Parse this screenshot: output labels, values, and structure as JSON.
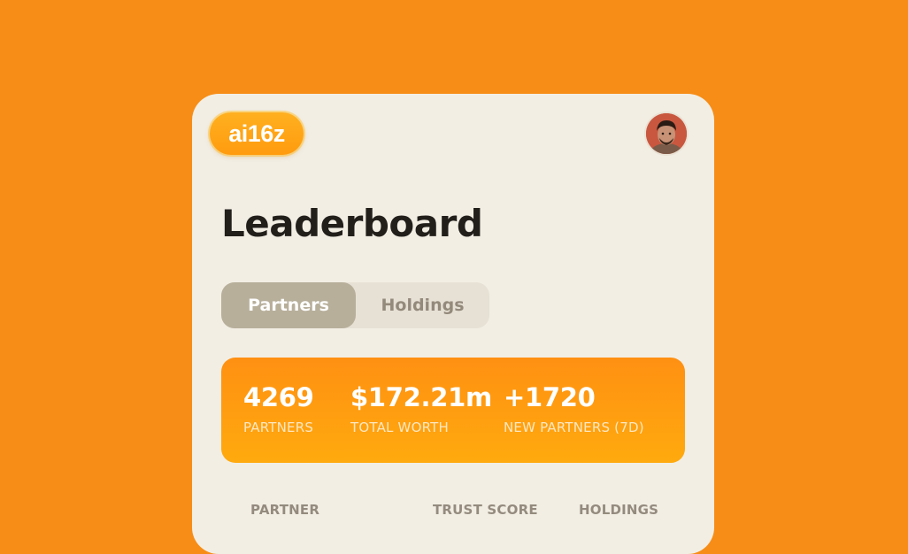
{
  "app": {
    "logo_text": "ai16z"
  },
  "header": {
    "avatar_icon": "user-avatar-photo"
  },
  "page": {
    "title": "Leaderboard"
  },
  "tabs": [
    {
      "label": "Partners",
      "active": true
    },
    {
      "label": "Holdings",
      "active": false
    }
  ],
  "stats": [
    {
      "value": "4269",
      "label": "PARTNERS"
    },
    {
      "value": "$172.21m",
      "label": "TOTAL WORTH"
    },
    {
      "value": "+1720",
      "label": "NEW PARTNERS (7D)"
    }
  ],
  "table": {
    "columns": [
      "PARTNER",
      "TRUST SCORE",
      "HOLDINGS"
    ]
  },
  "colors": {
    "background": "#F78D16",
    "card": "#F2EEE4",
    "accent": "#FF9B0E",
    "tab_active": "#B8AF9B",
    "tab_inactive_bg": "#E7E1D5"
  }
}
